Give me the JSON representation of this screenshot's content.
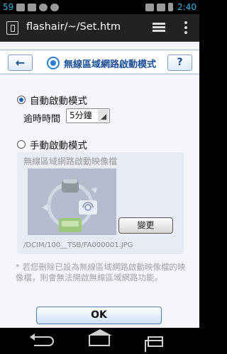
{
  "statusbar": {
    "notification_count": "59",
    "time": "2:40"
  },
  "actionbar": {
    "url_title": "flashair/~/Set.htm"
  },
  "header": {
    "title": "無線區域網路啟動模式",
    "back_label": "←",
    "help_label": "?"
  },
  "auto_mode": {
    "label": "自動啟動模式",
    "selected": true,
    "timeout_label": "逾時時間",
    "timeout_value": "5分鐘"
  },
  "manual_mode": {
    "label": "手動啟動模式",
    "selected": false,
    "image_label": "無線區域網路啟動映像檔",
    "change_label": "變更",
    "file_path": "/DCIM/100__TSB/FA000001.JPG"
  },
  "note": "* 若您刪除已設為無線區域網路啟動映像檔的映像檔，則會無法開啟無線區域網路功能。",
  "ok_label": "OK",
  "accent_color": "#1a4f98"
}
